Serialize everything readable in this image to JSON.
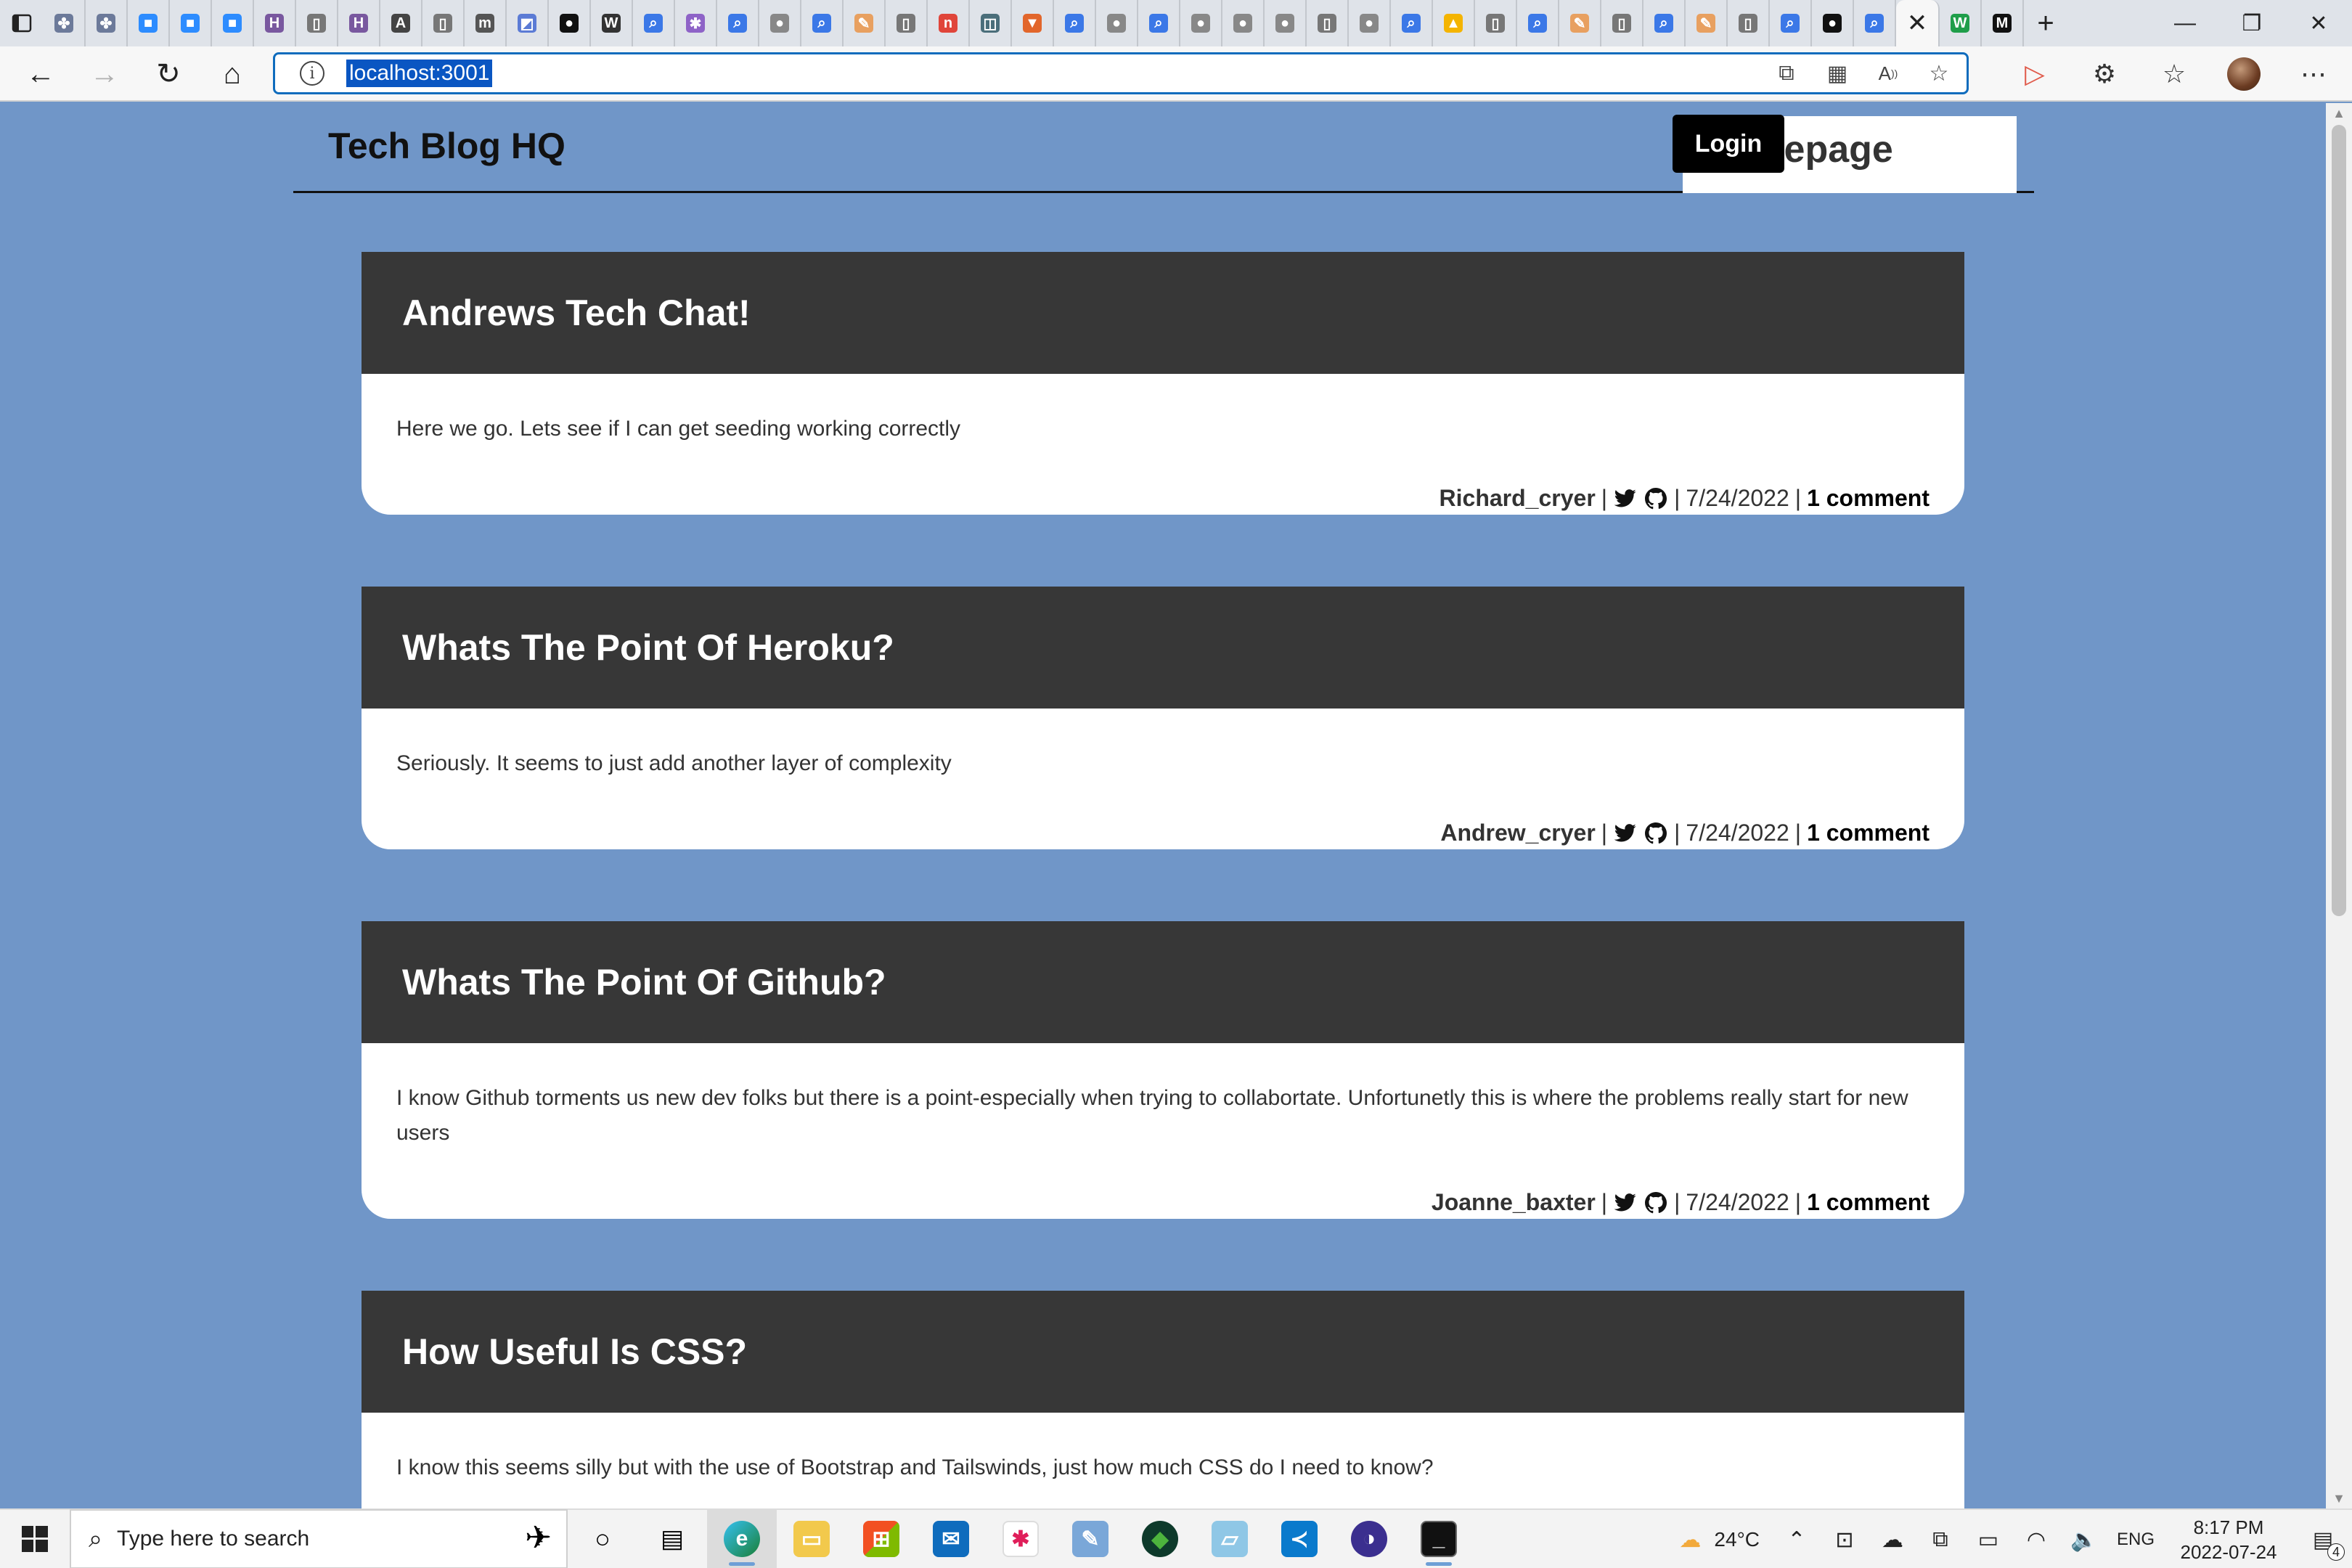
{
  "browser": {
    "tabs": [
      {
        "icon": "tab-icon-1",
        "color": "#6c7a9a",
        "glyph": "✤"
      },
      {
        "icon": "tab-icon-2",
        "color": "#6c7a9a",
        "glyph": "✤"
      },
      {
        "icon": "zoom-icon",
        "color": "#2d8cff",
        "glyph": "■"
      },
      {
        "icon": "zoom-icon",
        "color": "#2d8cff",
        "glyph": "■"
      },
      {
        "icon": "zoom-icon",
        "color": "#2d8cff",
        "glyph": "■"
      },
      {
        "icon": "heroku-icon",
        "color": "#79589f",
        "glyph": "H"
      },
      {
        "icon": "document-icon",
        "color": "#777777",
        "glyph": "▯"
      },
      {
        "icon": "heroku-icon",
        "color": "#79589f",
        "glyph": "H"
      },
      {
        "icon": "app-icon",
        "color": "#444444",
        "glyph": "A"
      },
      {
        "icon": "document-icon",
        "color": "#777777",
        "glyph": "▯"
      },
      {
        "icon": "m-icon",
        "color": "#555555",
        "glyph": "m"
      },
      {
        "icon": "image-icon",
        "color": "#5b7bd5",
        "glyph": "◩"
      },
      {
        "icon": "github-icon",
        "color": "#111111",
        "glyph": "●"
      },
      {
        "icon": "wordpress-icon",
        "color": "#333333",
        "glyph": "W"
      },
      {
        "icon": "search-icon",
        "color": "#3b78e7",
        "glyph": "⌕"
      },
      {
        "icon": "slack-icon",
        "color": "#8e63c7",
        "glyph": "✱"
      },
      {
        "icon": "search-icon",
        "color": "#3b78e7",
        "glyph": "⌕"
      },
      {
        "icon": "github-icon",
        "color": "#888888",
        "glyph": "●"
      },
      {
        "icon": "search-icon",
        "color": "#3b78e7",
        "glyph": "⌕"
      },
      {
        "icon": "feather-icon",
        "color": "#e8a060",
        "glyph": "✎"
      },
      {
        "icon": "document-icon",
        "color": "#777777",
        "glyph": "▯"
      },
      {
        "icon": "red-app-icon",
        "color": "#e0453a",
        "glyph": "n"
      },
      {
        "icon": "grid-app-icon",
        "color": "#4a6e7a",
        "glyph": "◫"
      },
      {
        "icon": "gitlab-icon",
        "color": "#e2662b",
        "glyph": "▼"
      },
      {
        "icon": "search-icon",
        "color": "#3b78e7",
        "glyph": "⌕"
      },
      {
        "icon": "github-icon",
        "color": "#888888",
        "glyph": "●"
      },
      {
        "icon": "search-icon",
        "color": "#3b78e7",
        "glyph": "⌕"
      },
      {
        "icon": "github-icon",
        "color": "#888888",
        "glyph": "●"
      },
      {
        "icon": "github-icon",
        "color": "#888888",
        "glyph": "●"
      },
      {
        "icon": "github-icon",
        "color": "#888888",
        "glyph": "●"
      },
      {
        "icon": "document-icon",
        "color": "#777777",
        "glyph": "▯"
      },
      {
        "icon": "github-icon",
        "color": "#888888",
        "glyph": "●"
      },
      {
        "icon": "search-icon",
        "color": "#3b78e7",
        "glyph": "⌕"
      },
      {
        "icon": "google-drive-icon",
        "color": "#f4b400",
        "glyph": "▲"
      },
      {
        "icon": "document-icon",
        "color": "#777777",
        "glyph": "▯"
      },
      {
        "icon": "search-icon",
        "color": "#3b78e7",
        "glyph": "⌕"
      },
      {
        "icon": "feather-icon",
        "color": "#e8a060",
        "glyph": "✎"
      },
      {
        "icon": "document-icon",
        "color": "#777777",
        "glyph": "▯"
      },
      {
        "icon": "search-icon",
        "color": "#3b78e7",
        "glyph": "⌕"
      },
      {
        "icon": "feather-icon",
        "color": "#e8a060",
        "glyph": "✎"
      },
      {
        "icon": "document-icon",
        "color": "#777777",
        "glyph": "▯"
      },
      {
        "icon": "search-icon",
        "color": "#3b78e7",
        "glyph": "⌕"
      },
      {
        "icon": "github-icon",
        "color": "#111111",
        "glyph": "●"
      },
      {
        "icon": "search-icon",
        "color": "#3b78e7",
        "glyph": "⌕"
      }
    ],
    "active_tab_close": "✕",
    "extra_tabs": [
      {
        "icon": "w-icon",
        "color": "#1f9e4a",
        "glyph": "W"
      },
      {
        "icon": "m-icon",
        "color": "#111111",
        "glyph": "M"
      }
    ],
    "new_tab": "+",
    "url": "localhost:3001"
  },
  "site": {
    "title": "Tech Blog HQ",
    "nav_home": "Homepage",
    "nav_login": "Login"
  },
  "posts": [
    {
      "title": "Andrews Tech Chat!",
      "content": "Here we go. Lets see if I can get seeding working correctly",
      "author": "Richard_cryer",
      "date": "7/24/2022",
      "comments": "1 comment"
    },
    {
      "title": "Whats The Point Of Heroku?",
      "content": "Seriously. It seems to just add another layer of complexity",
      "author": "Andrew_cryer",
      "date": "7/24/2022",
      "comments": "1 comment"
    },
    {
      "title": "Whats The Point Of Github?",
      "content": "I know Github torments us new dev folks but there is a point-especially when trying to collabortate. Unfortunetly this is where the problems really start for new users",
      "author": "Joanne_baxter",
      "date": "7/24/2022",
      "comments": "1 comment"
    },
    {
      "title": "How Useful Is CSS?",
      "content": "I know this seems silly but with the use of Bootstrap and Tailswinds, just how much CSS do I need to know?",
      "author": "",
      "date": "",
      "comments": ""
    }
  ],
  "taskbar": {
    "search_placeholder": "Type here to search",
    "weather": "24°C",
    "language": "ENG",
    "time": "8:17 PM",
    "date": "2022-07-24",
    "notification_count": "4"
  }
}
